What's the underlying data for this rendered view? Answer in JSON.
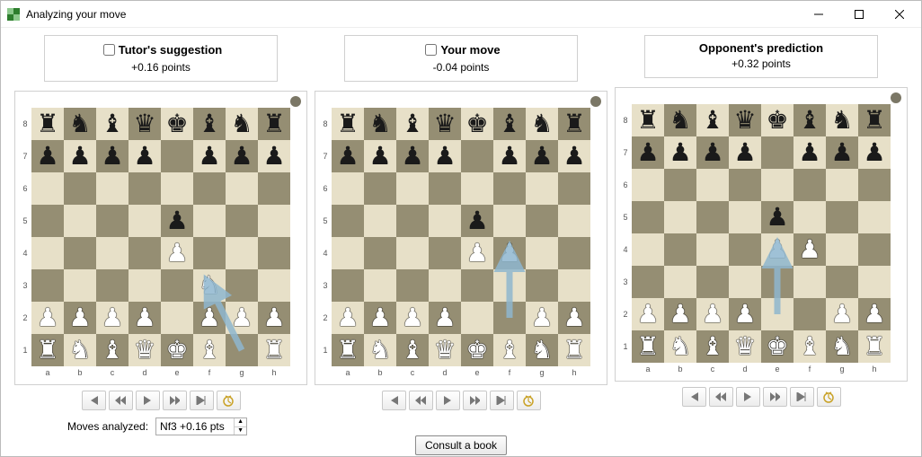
{
  "window": {
    "title": "Analyzing your move"
  },
  "panels": [
    {
      "title": "Tutor's suggestion",
      "checkbox": true,
      "score": "+0.16 points",
      "board": {
        "ranks": [
          "8",
          "7",
          "6",
          "5",
          "4",
          "3",
          "2",
          "1"
        ],
        "files": [
          "a",
          "b",
          "c",
          "d",
          "e",
          "f",
          "g",
          "h"
        ],
        "position": [
          [
            "r",
            "n",
            "b",
            "q",
            "k",
            "b",
            "n",
            "r"
          ],
          [
            "p",
            "p",
            "p",
            "p",
            ".",
            "p",
            "p",
            "p"
          ],
          [
            ".",
            ".",
            ".",
            ".",
            ".",
            ".",
            ".",
            "."
          ],
          [
            ".",
            ".",
            ".",
            ".",
            "p",
            ".",
            ".",
            "."
          ],
          [
            ".",
            ".",
            ".",
            ".",
            "P",
            ".",
            ".",
            "."
          ],
          [
            ".",
            ".",
            ".",
            ".",
            ".",
            "N",
            ".",
            "."
          ],
          [
            "P",
            "P",
            "P",
            "P",
            ".",
            "P",
            "P",
            "P"
          ],
          [
            "R",
            "N",
            "B",
            "Q",
            "K",
            "B",
            ".",
            "R"
          ]
        ],
        "arrow": {
          "from": "g1",
          "to": "f3"
        }
      }
    },
    {
      "title": "Your move",
      "checkbox": true,
      "score": "-0.04 points",
      "board": {
        "ranks": [
          "8",
          "7",
          "6",
          "5",
          "4",
          "3",
          "2",
          "1"
        ],
        "files": [
          "a",
          "b",
          "c",
          "d",
          "e",
          "f",
          "g",
          "h"
        ],
        "position": [
          [
            "r",
            "n",
            "b",
            "q",
            "k",
            "b",
            "n",
            "r"
          ],
          [
            "p",
            "p",
            "p",
            "p",
            ".",
            "p",
            "p",
            "p"
          ],
          [
            ".",
            ".",
            ".",
            ".",
            ".",
            ".",
            ".",
            "."
          ],
          [
            ".",
            ".",
            ".",
            ".",
            "p",
            ".",
            ".",
            "."
          ],
          [
            ".",
            ".",
            ".",
            ".",
            "P",
            "P",
            ".",
            "."
          ],
          [
            ".",
            ".",
            ".",
            ".",
            ".",
            ".",
            ".",
            "."
          ],
          [
            "P",
            "P",
            "P",
            "P",
            ".",
            ".",
            "P",
            "P"
          ],
          [
            "R",
            "N",
            "B",
            "Q",
            "K",
            "B",
            "N",
            "R"
          ]
        ],
        "arrow": {
          "from": "f2",
          "to": "f4"
        }
      }
    },
    {
      "title": "Opponent's prediction",
      "checkbox": false,
      "score": "+0.32 points",
      "board": {
        "ranks": [
          "8",
          "7",
          "6",
          "5",
          "4",
          "3",
          "2",
          "1"
        ],
        "files": [
          "a",
          "b",
          "c",
          "d",
          "e",
          "f",
          "g",
          "h"
        ],
        "position": [
          [
            "r",
            "n",
            "b",
            "q",
            "k",
            "b",
            "n",
            "r"
          ],
          [
            "p",
            "p",
            "p",
            "p",
            ".",
            "p",
            "p",
            "p"
          ],
          [
            ".",
            ".",
            ".",
            ".",
            ".",
            ".",
            ".",
            "."
          ],
          [
            ".",
            ".",
            ".",
            ".",
            "p",
            ".",
            ".",
            "."
          ],
          [
            ".",
            ".",
            ".",
            ".",
            "P",
            "P",
            ".",
            "."
          ],
          [
            ".",
            ".",
            ".",
            ".",
            ".",
            ".",
            ".",
            "."
          ],
          [
            "P",
            "P",
            "P",
            "P",
            ".",
            ".",
            "P",
            "P"
          ],
          [
            "R",
            "N",
            "B",
            "Q",
            "K",
            "B",
            "N",
            "R"
          ]
        ],
        "arrow": {
          "from": "e2",
          "to": "e4"
        }
      }
    }
  ],
  "nav_icons": [
    "first",
    "back",
    "play",
    "fwd",
    "last",
    "clock"
  ],
  "footer": {
    "label": "Moves analyzed:",
    "selected": "Nf3 +0.16 pts",
    "consult": "Consult a book"
  },
  "piece_glyph": {
    "K": "♔",
    "Q": "♕",
    "R": "♖",
    "B": "♗",
    "N": "♘",
    "P": "♙",
    "k": "♚",
    "q": "♛",
    "r": "♜",
    "b": "♝",
    "n": "♞",
    "p": "♟"
  }
}
